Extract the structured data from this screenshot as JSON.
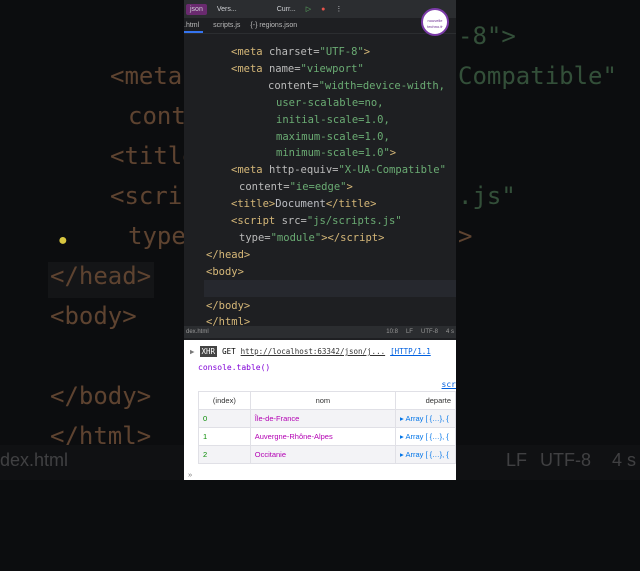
{
  "background": {
    "lines": [
      "<meta",
      "cont",
      "<title",
      "<scrip",
      "type",
      "</head>",
      "<body>",
      "</body>",
      "</html>"
    ],
    "right": [
      "-8\">",
      "Compatible\"",
      ".js\"",
      ">"
    ],
    "status_file": "dex.html",
    "status_items": [
      "LF",
      "UTF-8",
      "4 s"
    ]
  },
  "titlebar": {
    "project": "json",
    "vcs": "Vers...",
    "config": "Curr..."
  },
  "tabs": [
    {
      "label": ".html"
    },
    {
      "label": "scripts.js"
    },
    {
      "label": "{-} regions.json"
    }
  ],
  "code": [
    [
      [
        "tag",
        "<meta "
      ],
      [
        "attr",
        "charset="
      ],
      [
        "str",
        "\"UTF-8\""
      ],
      [
        "tag",
        ">"
      ]
    ],
    [
      [
        "tag",
        "<meta "
      ],
      [
        "attr",
        "name="
      ],
      [
        "str",
        "\"viewport\""
      ]
    ],
    [
      [
        "attr",
        "content="
      ],
      [
        "str",
        "\"width=device-width,"
      ]
    ],
    [
      [
        "str",
        "user-scalable=no,"
      ]
    ],
    [
      [
        "str",
        "initial-scale=1.0,"
      ]
    ],
    [
      [
        "str",
        "maximum-scale=1.0,"
      ]
    ],
    [
      [
        "str",
        "minimum-scale=1.0\""
      ],
      [
        "tag",
        ">"
      ]
    ],
    [
      [
        "tag",
        "<meta "
      ],
      [
        "attr",
        "http-equiv="
      ],
      [
        "str",
        "\"X-UA-Compatible\""
      ]
    ],
    [
      [
        "attr",
        "content="
      ],
      [
        "str",
        "\"ie=edge\""
      ],
      [
        "tag",
        ">"
      ]
    ],
    [
      [
        "tag",
        "<title>"
      ],
      [
        "txt",
        "Document"
      ],
      [
        "tag",
        "</title>"
      ]
    ],
    [
      [
        "tag",
        "<script "
      ],
      [
        "attr",
        "src="
      ],
      [
        "str",
        "\"js/scripts.js\""
      ]
    ],
    [
      [
        "attr",
        "type="
      ],
      [
        "str",
        "\"module\""
      ],
      [
        "tag",
        "></script>"
      ]
    ],
    [
      [
        "tag",
        "</head>"
      ]
    ],
    [
      [
        "tag",
        "<body>"
      ]
    ],
    [],
    [
      [
        "tag",
        "</body>"
      ]
    ],
    [
      [
        "tag",
        "</html>"
      ]
    ]
  ],
  "statusbar": {
    "file": "dex.html",
    "pos": "10:8",
    "lf": "LF",
    "enc": "UTF-8",
    "indent": "4 s"
  },
  "console": {
    "xhr": "XHR",
    "method": "GET",
    "url": "http://localhost:63342/json/j...",
    "http": "[HTTP/1.1",
    "call": "console.table()",
    "source": "scr",
    "headers": [
      "(index)",
      "nom",
      "departe"
    ],
    "rows": [
      {
        "index": "0",
        "nom": "Île-de-France",
        "dep": "▸ Array [ {…}, {"
      },
      {
        "index": "1",
        "nom": "Auvergne-Rhône-Alpes",
        "dep": "▸ Array [ {…}, {"
      },
      {
        "index": "2",
        "nom": "Occitanie",
        "dep": "▸ Array [ {…}, {"
      }
    ],
    "prompt": "»"
  },
  "logo": "nouvelle techno.fr"
}
